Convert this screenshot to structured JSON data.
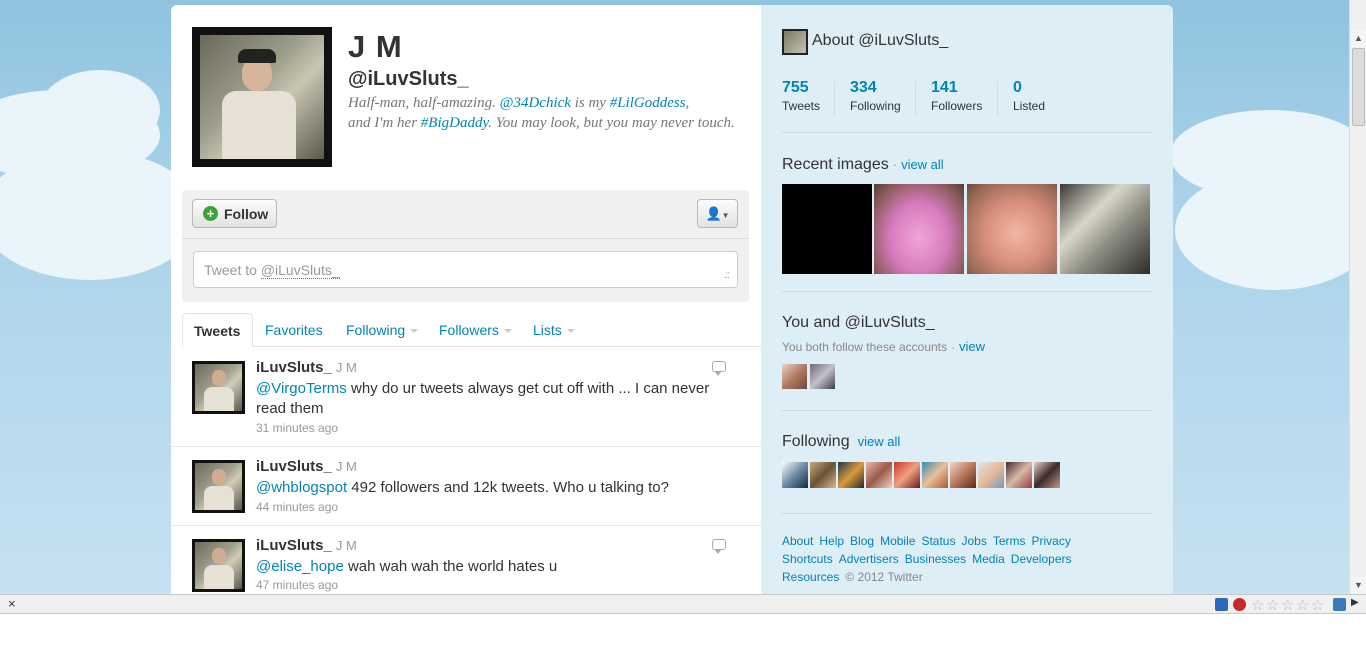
{
  "profile": {
    "name": "J M",
    "handle": "@iLuvSluts_",
    "bio_parts": {
      "a": "Half-man, half-amazing. ",
      "b": "@34Dchick",
      "c": " is my ",
      "d": "#LilGoddess",
      "e": ",",
      "f": "and I'm her ",
      "g": "#BigDaddy",
      "h": ". You may look, but you may never touch."
    }
  },
  "actions": {
    "follow_label": "Follow",
    "follow_icon": "plus-circle-icon",
    "user_menu_icon": "user-icon",
    "tweet_to_prefix": "Tweet to ",
    "tweet_to_handle": "@iLuvSluts_"
  },
  "tabs": [
    {
      "label": "Tweets"
    },
    {
      "label": "Favorites"
    },
    {
      "label": "Following"
    },
    {
      "label": "Followers"
    },
    {
      "label": "Lists"
    }
  ],
  "tweets": [
    {
      "user": "iLuvSluts_",
      "fullname": "J M",
      "mention": "@VirgoTerms",
      "text": " why do ur tweets always get cut off with ... I can never read them",
      "time": "31 minutes ago"
    },
    {
      "user": "iLuvSluts_",
      "fullname": "J M",
      "mention": "@whblogspot",
      "text": " 492 followers and 12k tweets. Who u talking to?",
      "time": "44 minutes ago"
    },
    {
      "user": "iLuvSluts_",
      "fullname": "J M",
      "mention": "@elise_hope",
      "text": " wah wah wah the world hates u",
      "time": "47 minutes ago"
    }
  ],
  "sidebar": {
    "about_title": "About @iLuvSluts_",
    "stats": [
      {
        "num": "755",
        "label": "Tweets"
      },
      {
        "num": "334",
        "label": "Following"
      },
      {
        "num": "141",
        "label": "Followers"
      },
      {
        "num": "0",
        "label": "Listed"
      }
    ],
    "recent_images_title": "Recent images",
    "recent_images_view": "view all",
    "you_and_title": "You and @iLuvSluts_",
    "you_both_text": "You both follow these accounts",
    "you_both_view": "view",
    "following_title": "Following",
    "following_view": "view all",
    "footer_links": [
      "About",
      "Help",
      "Blog",
      "Mobile",
      "Status",
      "Jobs",
      "Terms",
      "Privacy",
      "Shortcuts",
      "Advertisers",
      "Businesses",
      "Media",
      "Developers",
      "Resources"
    ],
    "copyright": "© 2012 Twitter"
  },
  "status_bar": {
    "close_label": "×"
  },
  "colors": {
    "link": "#0084b4",
    "sidebar_bg": "#ddeef6",
    "sky": "#a9d2ea"
  }
}
